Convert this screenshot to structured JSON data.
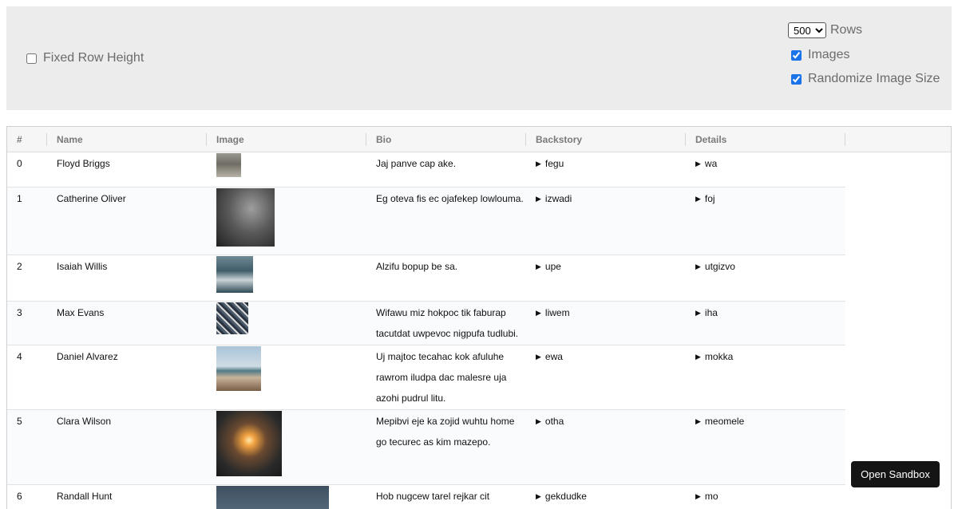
{
  "controls": {
    "fixed_row_height_label": "Fixed Row Height",
    "rows_select_value": "500",
    "rows_label": "Rows",
    "images_label": "Images",
    "randomize_label": "Randomize Image Size"
  },
  "table": {
    "headers": [
      "#",
      "Name",
      "Image",
      "Bio",
      "Backstory",
      "Details"
    ],
    "rows": [
      {
        "index": "0",
        "name": "Floyd Briggs",
        "bio": "Jaj panve cap ake.",
        "backstory": "fegu",
        "details": "wa"
      },
      {
        "index": "1",
        "name": "Catherine Oliver",
        "bio": "Eg oteva fis ec ojafekep lowlouma.",
        "backstory": "izwadi",
        "details": "foj"
      },
      {
        "index": "2",
        "name": "Isaiah Willis",
        "bio": "Alzifu bopup be sa.",
        "backstory": "upe",
        "details": "utgizvo"
      },
      {
        "index": "3",
        "name": "Max Evans",
        "bio": "Wifawu miz hokpoc tik faburap tacutdat uwpevoc nigpufa tudlubi.",
        "backstory": "liwem",
        "details": "iha"
      },
      {
        "index": "4",
        "name": "Daniel Alvarez",
        "bio": "Uj majtoc tecahac kok afuluhe rawrom iludpa dac malesre uja azohi pudrul litu.",
        "backstory": "ewa",
        "details": "mokka"
      },
      {
        "index": "5",
        "name": "Clara Wilson",
        "bio": "Mepibvi eje ka zojid wuhtu home go tecurec as kim mazepo.",
        "backstory": "otha",
        "details": "meomele"
      },
      {
        "index": "6",
        "name": "Randall Hunt",
        "bio": "Hob nugcew tarel rejkar cit",
        "backstory": "gekdudke",
        "details": "mo"
      }
    ]
  },
  "sandbox_button_label": "Open Sandbox",
  "icons": {
    "disclosure": "disclosure-triangle-icon"
  }
}
